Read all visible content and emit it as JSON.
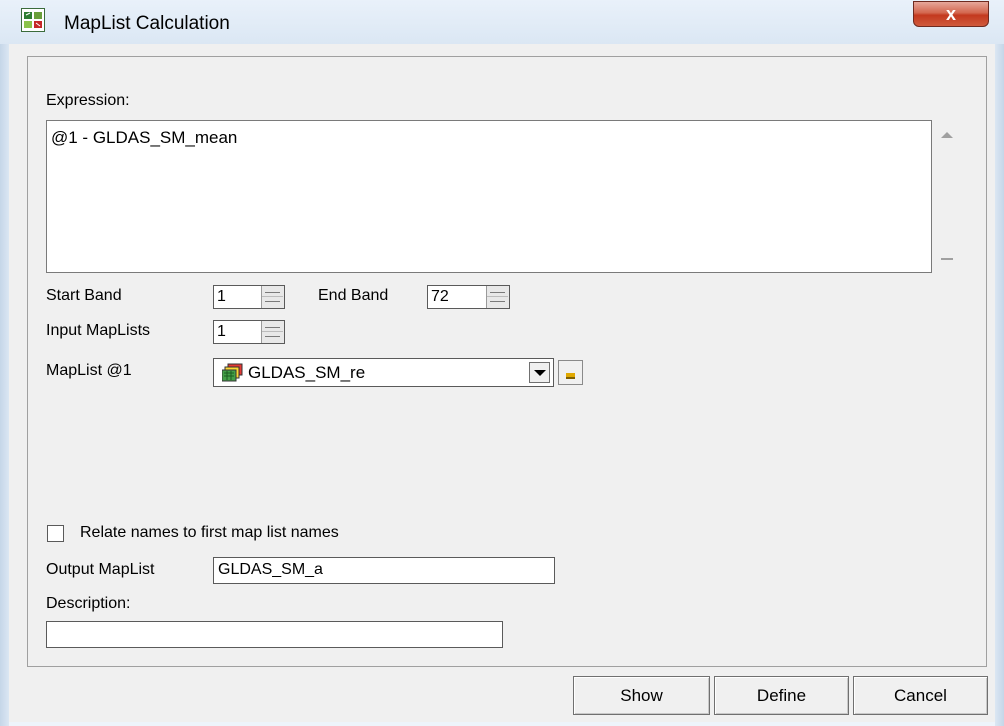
{
  "window": {
    "title": "MapList Calculation",
    "close_label": "x"
  },
  "expression": {
    "label": "Expression:",
    "value": "@1 - GLDAS_SM_mean"
  },
  "start_band": {
    "label": "Start Band",
    "value": "1"
  },
  "end_band": {
    "label": "End Band",
    "value": "72"
  },
  "input_maplists": {
    "label": "Input MapLists",
    "value": "1"
  },
  "maplist1": {
    "label": "MapList @1",
    "value": "GLDAS_SM_re",
    "icon": "maplist-icon"
  },
  "relate_names": {
    "label": "Relate names to first map list names",
    "checked": false
  },
  "output_maplist": {
    "label": "Output MapList",
    "value": "GLDAS_SM_a"
  },
  "description": {
    "label": "Description:",
    "value": ""
  },
  "buttons": {
    "show": "Show",
    "define": "Define",
    "cancel": "Cancel"
  },
  "colors": {
    "title_bar": "#dbe7f4",
    "close_button": "#c3391f",
    "client_bg": "#f0f0f0"
  }
}
